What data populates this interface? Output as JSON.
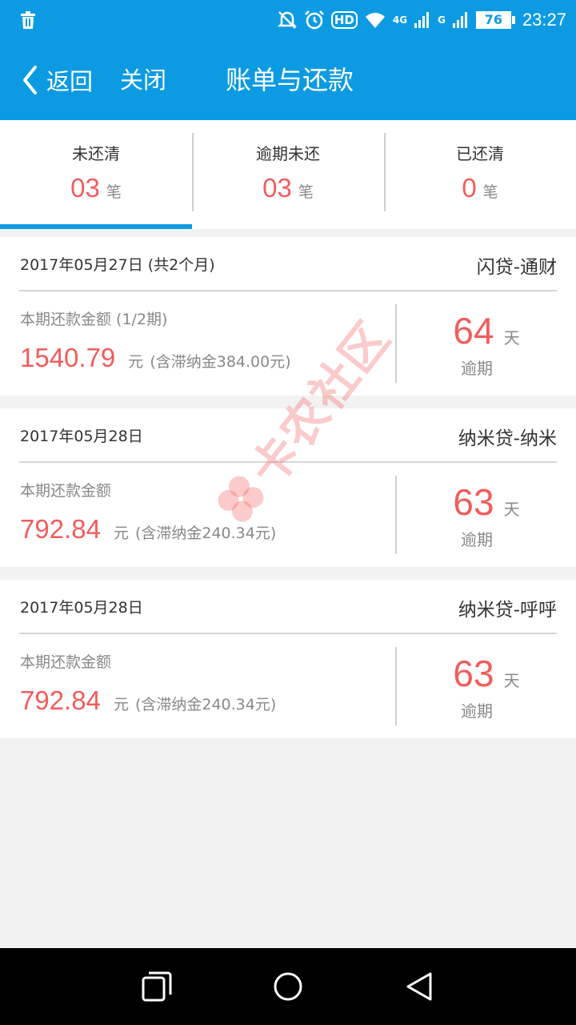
{
  "status_bar": {
    "icons": [
      "trash-icon",
      "alarm-off-icon",
      "alarm-clock-icon",
      "hd-icon",
      "wifi-icon",
      "signal-4g-icon",
      "signal-g-icon"
    ],
    "hd": "HD",
    "net_4g": "4G",
    "net_g": "G",
    "battery": "76",
    "time": "23:27"
  },
  "nav": {
    "back_label": "返回",
    "close_label": "关闭",
    "title": "账单与还款"
  },
  "tabs": [
    {
      "label": "未还清",
      "count": "03",
      "unit": "笔",
      "active": true
    },
    {
      "label": "逾期未还",
      "count": "03",
      "unit": "笔",
      "active": false
    },
    {
      "label": "已还清",
      "count": "0",
      "unit": "笔",
      "active": false
    }
  ],
  "bills": [
    {
      "date": "2017年05月27日 (共2个月)",
      "product": "闪贷-通财",
      "amount_label": "本期还款金额 (1/2期)",
      "amount": "1540.79",
      "currency": "元",
      "penalty": "(含滞纳金384.00元)",
      "days": "64",
      "days_unit": "天",
      "status": "逾期"
    },
    {
      "date": "2017年05月28日",
      "product": "纳米贷-纳米",
      "amount_label": "本期还款金额",
      "amount": "792.84",
      "currency": "元",
      "penalty": "(含滞纳金240.34元)",
      "days": "63",
      "days_unit": "天",
      "status": "逾期"
    },
    {
      "date": "2017年05月28日",
      "product": "纳米贷-呼呼",
      "amount_label": "本期还款金额",
      "amount": "792.84",
      "currency": "元",
      "penalty": "(含滞纳金240.34元)",
      "days": "63",
      "days_unit": "天",
      "status": "逾期"
    }
  ],
  "watermark": "卡农社区",
  "colors": {
    "brand_blue": "#0c9be3",
    "accent_red": "#f25c5c",
    "muted_text": "#888888",
    "background": "#f2f2f2"
  },
  "system_nav": [
    "recent-apps-icon",
    "home-icon",
    "back-triangle-icon"
  ]
}
